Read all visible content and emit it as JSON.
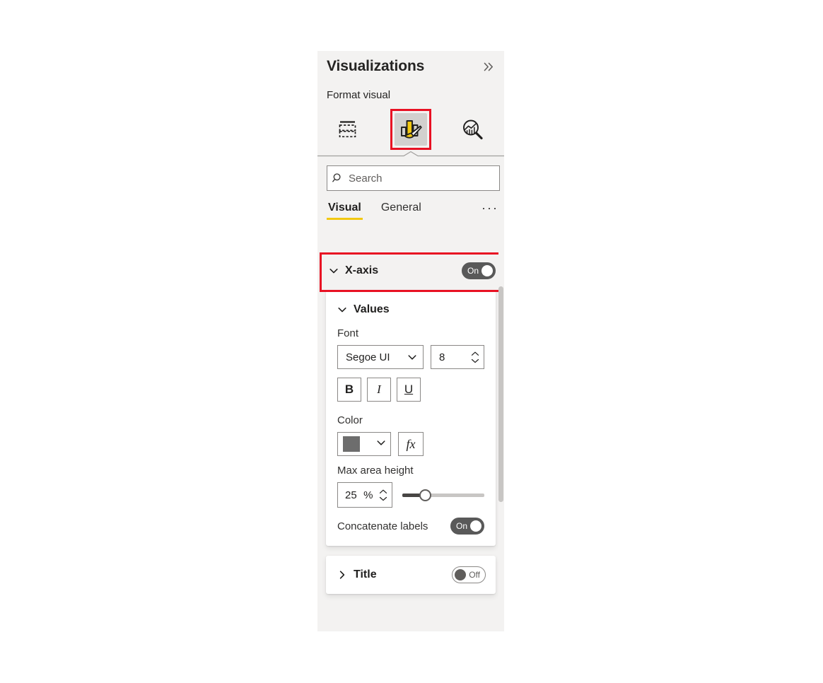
{
  "panel": {
    "title": "Visualizations",
    "collapse_icon": "chevron-double-right-icon",
    "subtitle": "Format visual"
  },
  "toolbar": {
    "buttons": [
      {
        "name": "build-visual",
        "icon": "fields-table-icon",
        "selected": false
      },
      {
        "name": "format-visual",
        "icon": "paintbrush-bar-chart-icon",
        "selected": true
      },
      {
        "name": "analytics",
        "icon": "analytics-magnifier-icon",
        "selected": false
      }
    ]
  },
  "search": {
    "placeholder": "Search",
    "value": "",
    "icon": "search-icon"
  },
  "tabs": {
    "items": [
      {
        "label": "Visual",
        "active": true
      },
      {
        "label": "General",
        "active": false
      }
    ],
    "more_label": "···"
  },
  "sections": {
    "xaxis": {
      "title": "X-axis",
      "expanded": true,
      "chevron": "chevron-down-icon",
      "toggle": {
        "state": "on",
        "label": "On"
      },
      "values": {
        "title": "Values",
        "chevron": "chevron-down-icon",
        "font_label": "Font",
        "font_family": "Segoe UI",
        "font_size": "8",
        "bold_label": "B",
        "italic_label": "I",
        "underline_label": "U",
        "color_label": "Color",
        "color_value": "#6d6d6d",
        "fx_label": "fx",
        "max_area_height_label": "Max area height",
        "max_area_height_value": "25",
        "max_area_height_unit": "%",
        "slider_percent": 28,
        "concatenate_label": "Concatenate labels",
        "concatenate_toggle": {
          "state": "on",
          "label": "On"
        }
      }
    },
    "title": {
      "title": "Title",
      "expanded": false,
      "chevron": "chevron-right-icon",
      "toggle": {
        "state": "off",
        "label": "Off"
      }
    }
  },
  "annotations": {
    "accent_color": "#e81123",
    "highlights": [
      "format-visual-icon",
      "x-axis-row"
    ]
  }
}
